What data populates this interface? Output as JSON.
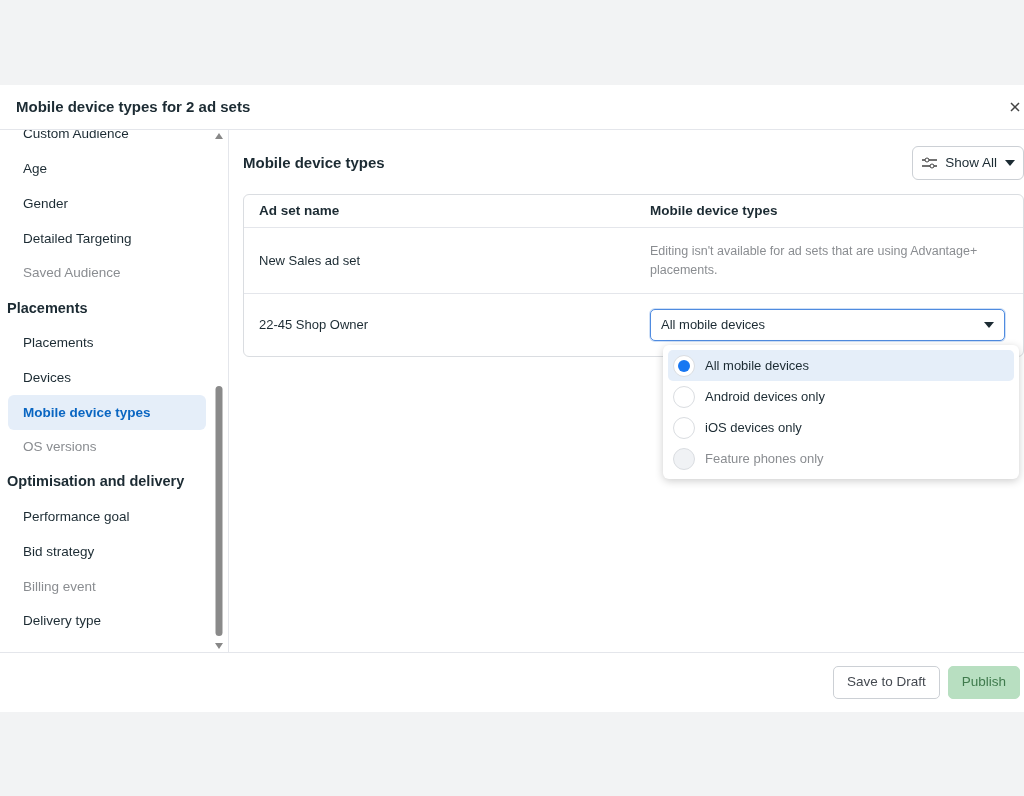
{
  "dialog": {
    "title": "Mobile device types for 2 ad sets"
  },
  "sidebar": {
    "items": [
      {
        "kind": "item",
        "label": "Custom Audience",
        "selected": false,
        "disabled": false
      },
      {
        "kind": "item",
        "label": "Age",
        "selected": false,
        "disabled": false
      },
      {
        "kind": "item",
        "label": "Gender",
        "selected": false,
        "disabled": false
      },
      {
        "kind": "item",
        "label": "Detailed Targeting",
        "selected": false,
        "disabled": false
      },
      {
        "kind": "item",
        "label": "Saved Audience",
        "selected": false,
        "disabled": true
      },
      {
        "kind": "heading",
        "label": "Placements"
      },
      {
        "kind": "item",
        "label": "Placements",
        "selected": false,
        "disabled": false
      },
      {
        "kind": "item",
        "label": "Devices",
        "selected": false,
        "disabled": false
      },
      {
        "kind": "item",
        "label": "Mobile device types",
        "selected": true,
        "disabled": false
      },
      {
        "kind": "item",
        "label": "OS versions",
        "selected": false,
        "disabled": true
      },
      {
        "kind": "heading",
        "label": "Optimisation and delivery"
      },
      {
        "kind": "item",
        "label": "Performance goal",
        "selected": false,
        "disabled": false
      },
      {
        "kind": "item",
        "label": "Bid strategy",
        "selected": false,
        "disabled": false
      },
      {
        "kind": "item",
        "label": "Billing event",
        "selected": false,
        "disabled": true
      },
      {
        "kind": "item",
        "label": "Delivery type",
        "selected": false,
        "disabled": false
      }
    ]
  },
  "main": {
    "title": "Mobile device types",
    "filter_button": "Show All",
    "table": {
      "columns": [
        "Ad set name",
        "Mobile device types"
      ],
      "rows": [
        {
          "kind": "note",
          "name": "New Sales ad set",
          "value": "Editing isn't available for ad sets that are using Advantage+ placements."
        },
        {
          "kind": "select",
          "name": "22-45 Shop Owner",
          "value": "All mobile devices",
          "expanded": true,
          "options": [
            {
              "label": "All mobile devices",
              "selected": true,
              "disabled": false
            },
            {
              "label": "Android devices only",
              "selected": false,
              "disabled": false
            },
            {
              "label": "iOS devices only",
              "selected": false,
              "disabled": false
            },
            {
              "label": "Feature phones only",
              "selected": false,
              "disabled": true
            }
          ]
        }
      ]
    }
  },
  "footer": {
    "buttons": [
      {
        "kind": "secondary",
        "label": "Save to Draft"
      },
      {
        "kind": "primary",
        "label": "Publish",
        "disabled": true
      }
    ]
  }
}
